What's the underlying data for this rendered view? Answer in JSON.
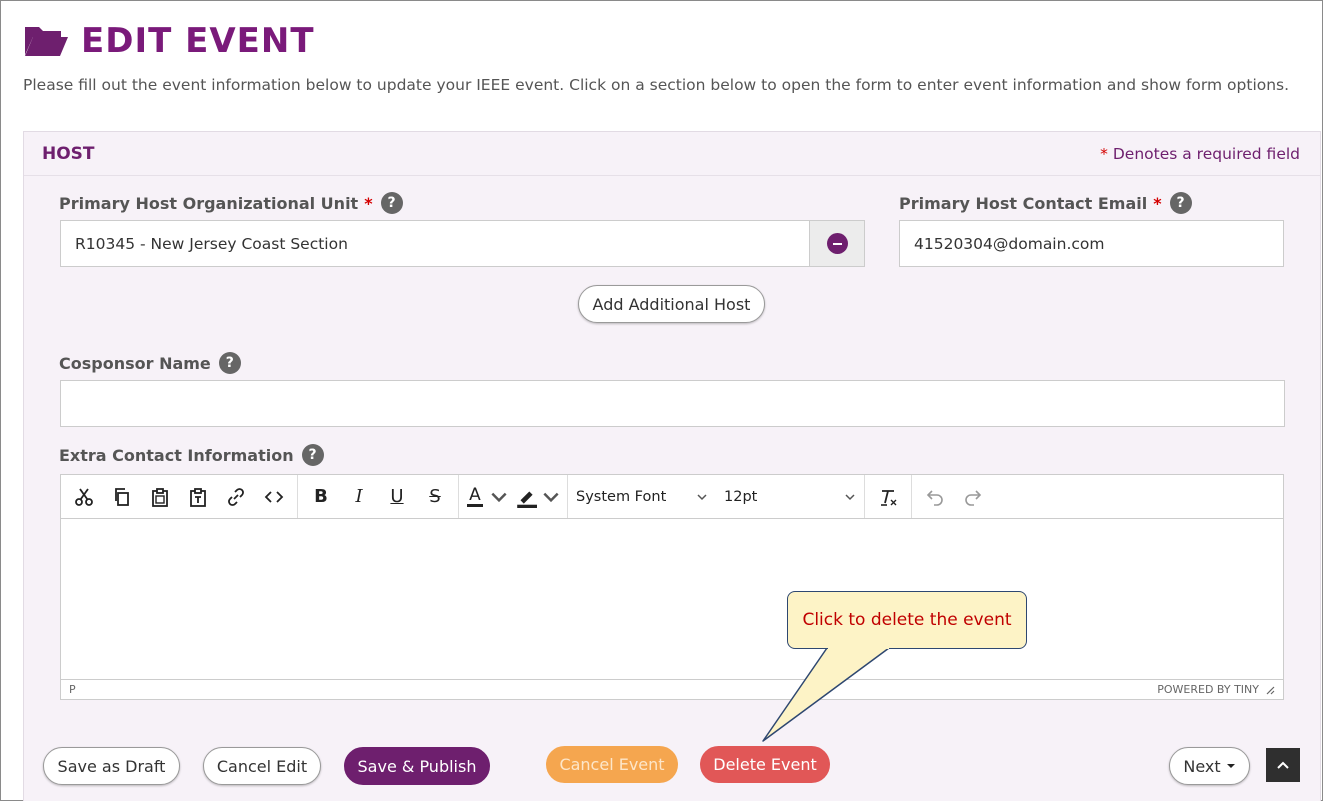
{
  "page": {
    "title": "EDIT EVENT",
    "intro": "Please fill out the event information below to update your IEEE event. Click on a section below to open the form to enter event information and show form options."
  },
  "section": {
    "title": "HOST",
    "required_star": "*",
    "required_note": "Denotes a required field"
  },
  "fields": {
    "primary_host": {
      "label": "Primary Host Organizational Unit",
      "required": "*",
      "help": "?",
      "value": "R10345 - New Jersey Coast Section"
    },
    "contact_email": {
      "label": "Primary Host Contact Email",
      "required": "*",
      "help": "?",
      "value": "41520304@domain.com"
    },
    "add_host_label": "Add Additional Host",
    "cosponsor": {
      "label": "Cosponsor Name",
      "help": "?",
      "value": ""
    },
    "extra_contact": {
      "label": "Extra Contact Information",
      "help": "?"
    }
  },
  "editor": {
    "toolbar_icons": [
      "cut-icon",
      "copy-icon",
      "paste-icon",
      "paste-text-icon",
      "link-icon",
      "code-icon",
      "bold-icon",
      "italic-icon",
      "underline-icon",
      "strikethrough-icon",
      "text-color-icon",
      "highlight-color-icon",
      "clear-formatting-icon",
      "undo-icon",
      "redo-icon"
    ],
    "bold": "B",
    "italic": "I",
    "underline": "U",
    "strike": "S",
    "font_color": "A",
    "font_family": "System Font",
    "font_size": "12pt",
    "path": "P",
    "branding": "POWERED BY TINY"
  },
  "callout": {
    "text": "Click to delete the event"
  },
  "buttons": {
    "save_draft": "Save as Draft",
    "cancel_edit": "Cancel Edit",
    "save_publish": "Save & Publish",
    "cancel_event": "Cancel Event",
    "delete_event": "Delete Event",
    "next": "Next"
  },
  "colors": {
    "brand_purple": "#6e1f6e",
    "required_red": "#d40000",
    "cancel_orange": "#f5a64f",
    "delete_red": "#e15757",
    "callout_fill": "#fdf3c6",
    "callout_text": "#c00000"
  }
}
